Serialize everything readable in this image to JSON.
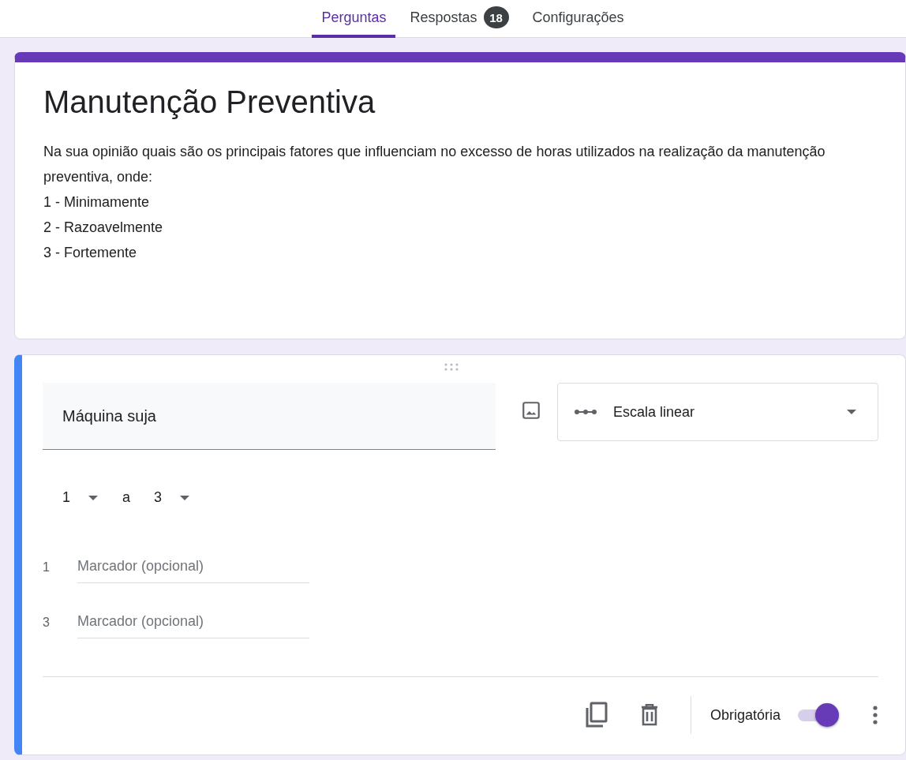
{
  "tabs": [
    {
      "label": "Perguntas",
      "selected": true
    },
    {
      "label": "Respostas",
      "selected": false,
      "badge": "18"
    },
    {
      "label": "Configurações",
      "selected": false
    }
  ],
  "form": {
    "title": "Manutenção Preventiva",
    "description": [
      "Na sua opinião quais são os principais fatores que influenciam no excesso de horas utilizados na realização da manutenção preventiva, onde:",
      "1 - Minimamente",
      "2 - Razoavelmente",
      "3 - Fortemente"
    ]
  },
  "question": {
    "title": "Máquina suja",
    "type": "Escala linear",
    "scale_from": "1",
    "scale_word": "a",
    "scale_to": "3",
    "labels": [
      {
        "number": "1",
        "placeholder": "Marcador (opcional)"
      },
      {
        "number": "3",
        "placeholder": "Marcador (opcional)"
      }
    ],
    "required_label": "Obrigatória",
    "required": true
  }
}
